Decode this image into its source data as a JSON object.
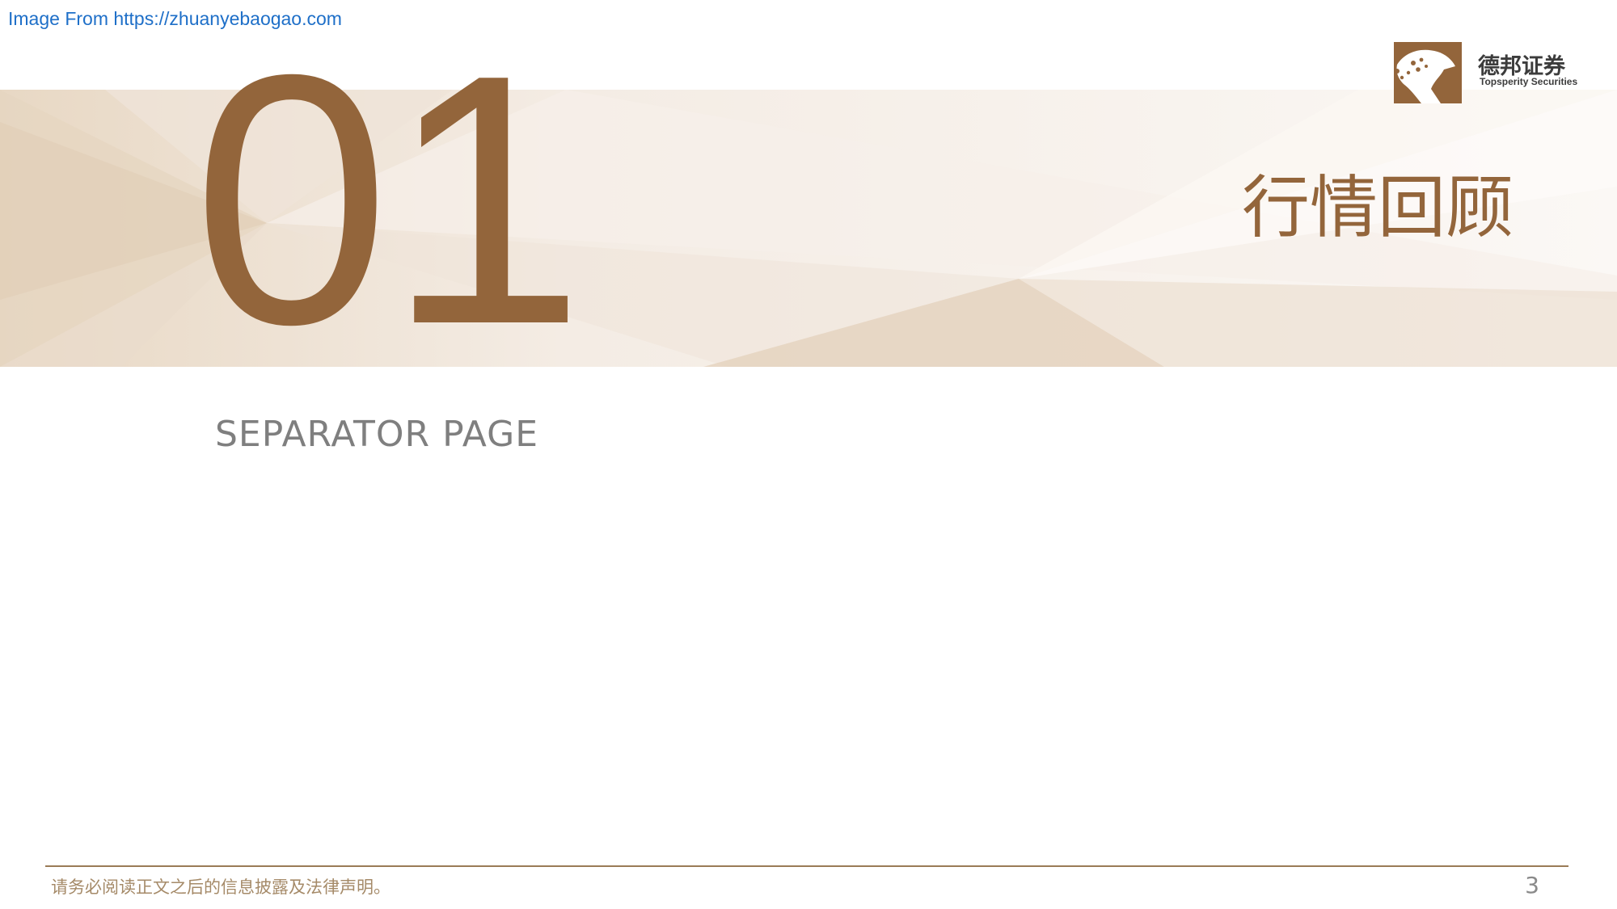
{
  "watermark": {
    "text": "Image From https://zhuanyebaogao.com"
  },
  "logo": {
    "icon": "leopard-logo-icon",
    "name_cn": "德邦证券",
    "name_en": "Topsperity Securities",
    "brand_color": "#93653b"
  },
  "section": {
    "number": "01",
    "title": "行情回顾",
    "subtitle": "SEPARATOR PAGE"
  },
  "footer": {
    "disclaimer": "请务必阅读正文之后的信息披露及法律声明。",
    "page_number": "3"
  },
  "colors": {
    "accent": "#93653b",
    "banner_base": "#f3ebe3",
    "subtitle_gray": "#7f7f7f",
    "link_blue": "#1e6fc8",
    "footer_rule": "#9a7b56"
  }
}
